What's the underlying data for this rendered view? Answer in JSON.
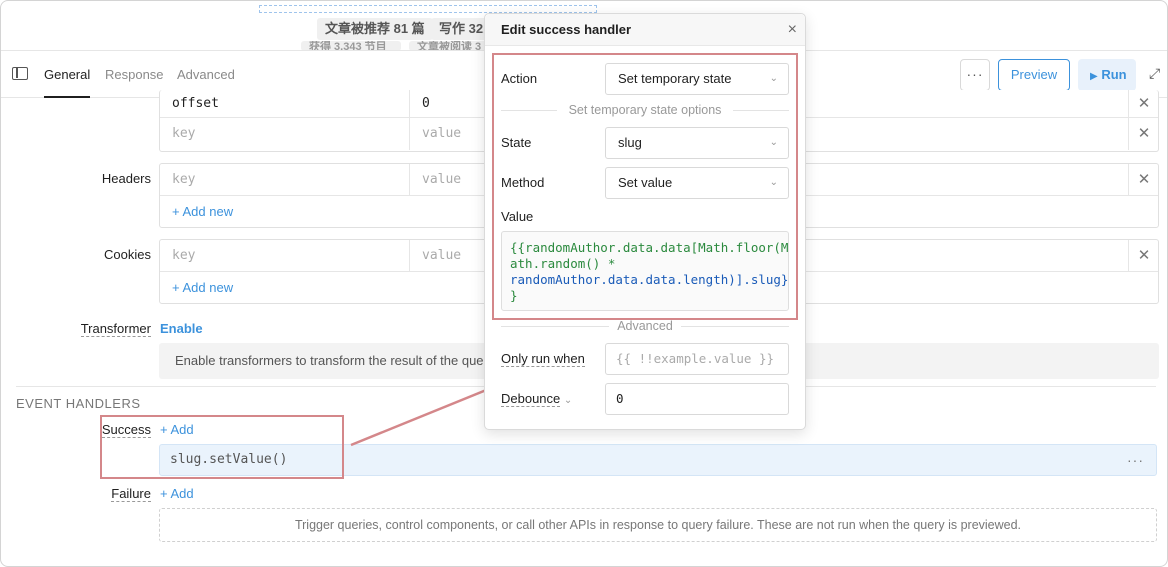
{
  "top_stats": [
    "文章被推荐 81 篇",
    "写作 321",
    "获得 3,343 节目",
    "文章被阅读 3"
  ],
  "toolbar": {
    "tabs": [
      "General",
      "Response",
      "Advanced"
    ],
    "more_label": "···",
    "preview_label": "Preview",
    "run_label": "Run",
    "run_icon": "play-icon"
  },
  "params": {
    "rows": [
      {
        "key": "offset",
        "value": "0"
      },
      {
        "key": "key",
        "value": "value"
      }
    ]
  },
  "headers": {
    "label": "Headers",
    "rows": [
      {
        "key": "key",
        "value": "value"
      }
    ],
    "add_label": "+ Add new"
  },
  "cookies": {
    "label": "Cookies",
    "rows": [
      {
        "key": "key",
        "value": "value"
      }
    ],
    "add_label": "+ Add new"
  },
  "transformer": {
    "label": "Transformer",
    "action": "Enable",
    "hint": "Enable transformers to transform the result of the query"
  },
  "event_handlers": {
    "title": "EVENT HANDLERS",
    "success_label": "Success",
    "failure_label": "Failure",
    "add_label": "+ Add",
    "success_handler": "slug.setValue()",
    "handler_menu": "···",
    "failure_empty": "Trigger queries, control components, or call other APIs in response to query failure. These are not run when the query is previewed."
  },
  "popover": {
    "title": "Edit success handler",
    "close": "×",
    "action_label": "Action",
    "action_value": "Set temporary state",
    "options_divider": "Set temporary state options",
    "state_label": "State",
    "state_value": "slug",
    "method_label": "Method",
    "method_value": "Set value",
    "value_label": "Value",
    "code_lines": [
      "{{randomAuthor.data.data[Math.floor(M",
      "ath.random() *",
      "randomAuthor.data.data.length)].slug}",
      "}"
    ],
    "advanced_divider": "Advanced",
    "only_run_label": "Only run when",
    "only_run_placeholder": "{{ !!example.value }}",
    "debounce_label": "Debounce",
    "debounce_value": "0"
  },
  "colors": {
    "accent": "#3c92dc",
    "annotation": "#d4878a",
    "handler_bg": "#eaf3fc"
  }
}
